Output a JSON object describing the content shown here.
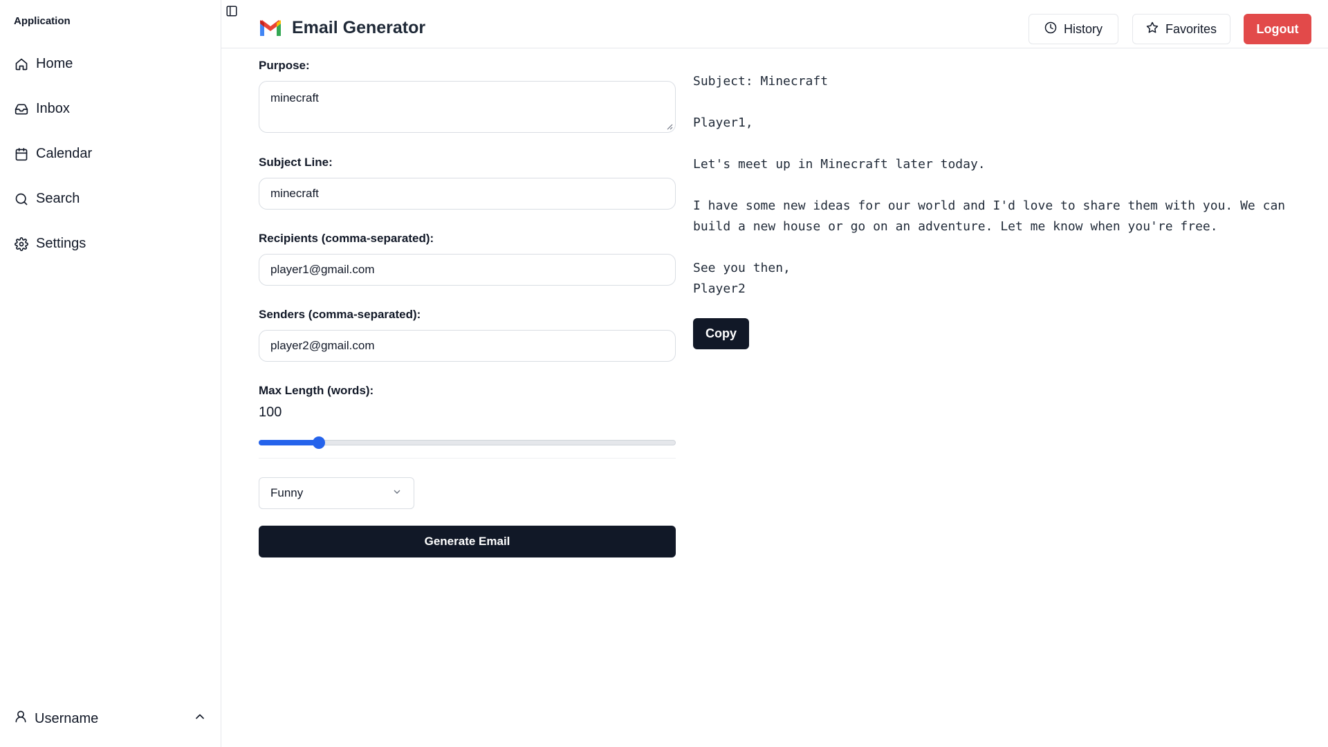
{
  "sidebar": {
    "group_label": "Application",
    "items": [
      {
        "label": "Home",
        "icon": "home-icon"
      },
      {
        "label": "Inbox",
        "icon": "inbox-icon"
      },
      {
        "label": "Calendar",
        "icon": "calendar-icon"
      },
      {
        "label": "Search",
        "icon": "search-icon"
      },
      {
        "label": "Settings",
        "icon": "gear-icon"
      }
    ],
    "user": {
      "name": "Username",
      "icon": "user-icon"
    }
  },
  "header": {
    "title": "Email Generator",
    "logo": "gmail-logo",
    "buttons": {
      "history": "History",
      "favorites": "Favorites",
      "logout": "Logout"
    },
    "colors": {
      "logout": "#e24a4a"
    }
  },
  "form": {
    "purpose": {
      "label": "Purpose:",
      "value": "minecraft"
    },
    "subject": {
      "label": "Subject Line:",
      "value": "minecraft"
    },
    "recipients": {
      "label": "Recipients (comma-separated):",
      "value": "player1@gmail.com"
    },
    "senders": {
      "label": "Senders (comma-separated):",
      "value": "player2@gmail.com"
    },
    "max_length": {
      "label": "Max Length (words):",
      "value": "100",
      "fraction": 0.145
    },
    "tone": {
      "selected": "Funny"
    },
    "generate_label": "Generate Email"
  },
  "output": {
    "subject_line": "Subject: Minecraft",
    "greeting": "Player1,",
    "para1": "Let's meet up in Minecraft later today.",
    "para2_line1": "I have some new ideas for our world and I'd love to share them with you. We can",
    "para2_line2": "build a new house or go on an adventure. Let me know when you're free.",
    "closing": "See you then,",
    "signature": "Player2",
    "copy_label": "Copy"
  }
}
